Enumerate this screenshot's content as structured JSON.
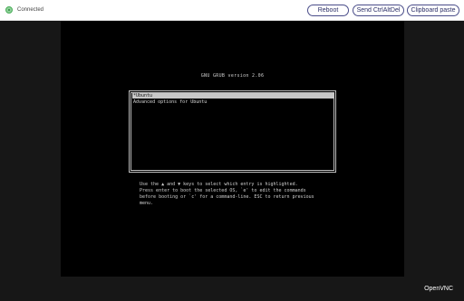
{
  "toolbar": {
    "status_text": "Connected",
    "status_color": "#4cae5a",
    "buttons": {
      "reboot": "Reboot",
      "ctrl_alt_del": "Send CtrlAltDel",
      "clipboard_paste": "Clipboard paste"
    }
  },
  "grub": {
    "title": "GNU GRUB  version 2.06",
    "entries": [
      {
        "label": "*Ubuntu",
        "selected": true
      },
      {
        "label": "Advanced options for Ubuntu",
        "selected": false
      }
    ],
    "help_lines": [
      "Use the ▲ and ▼ keys to select which entry is highlighted.",
      "Press enter to boot the selected OS, `e' to edit the commands",
      "before booting or `c' for a command-line. ESC to return previous",
      "menu."
    ]
  },
  "viewer": {
    "brand": "OpenVNC"
  }
}
